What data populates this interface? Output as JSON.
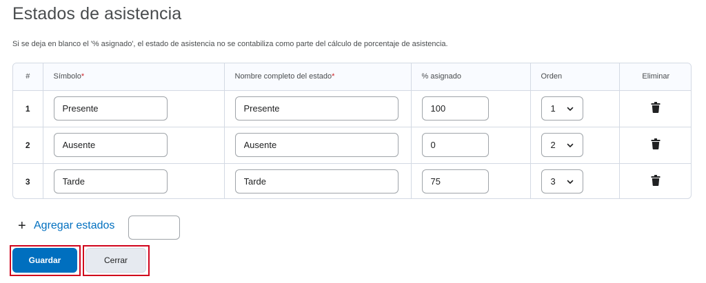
{
  "page": {
    "title": "Estados de asistencia",
    "info": "Si se deja en blanco el '% asignado', el estado de asistencia no se contabiliza como parte del cálculo de porcentaje de asistencia."
  },
  "table": {
    "headers": {
      "num": "#",
      "symbol": "Símbolo",
      "name": "Nombre completo del estado",
      "pct": "% asignado",
      "order": "Orden",
      "delete": "Eliminar",
      "required_mark": "*"
    },
    "rows": [
      {
        "num": "1",
        "symbol": "Presente",
        "name": "Presente",
        "pct": "100",
        "order": "1"
      },
      {
        "num": "2",
        "symbol": "Ausente",
        "name": "Ausente",
        "pct": "0",
        "order": "2"
      },
      {
        "num": "3",
        "symbol": "Tarde",
        "name": "Tarde",
        "pct": "75",
        "order": "3"
      }
    ]
  },
  "add": {
    "plus": "+",
    "label": "Agregar estados",
    "count_value": ""
  },
  "actions": {
    "save": "Guardar",
    "close": "Cerrar"
  },
  "colors": {
    "primary": "#006fbf",
    "highlight": "#d0021b",
    "required": "#cd2026"
  },
  "icons": {
    "delete": "trash-icon",
    "dropdown": "chevron-down-icon",
    "add": "plus-icon"
  }
}
